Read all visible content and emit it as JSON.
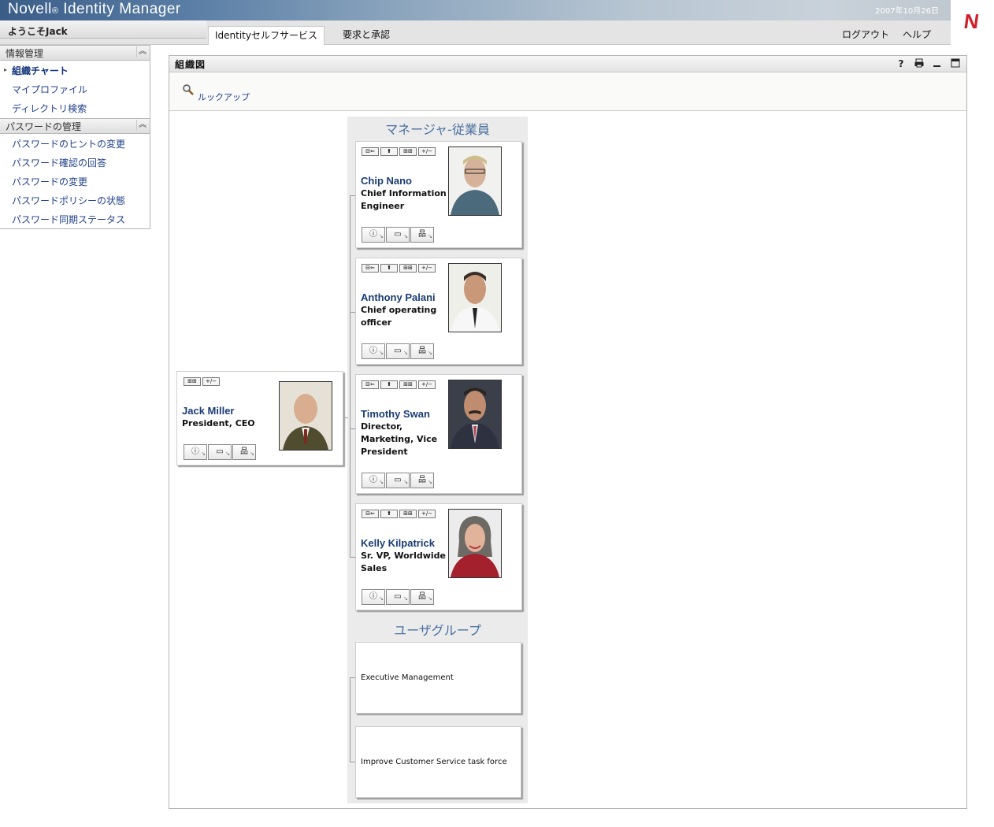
{
  "header": {
    "brand": "Novell",
    "brand_reg": "®",
    "product": "Identity Manager",
    "date": "2007年10月26日",
    "logo": "N",
    "welcome": "ようこそJack",
    "tabs": [
      "Identityセルフサービス",
      "要求と承認"
    ],
    "links": {
      "logout": "ログアウト",
      "help": "ヘルプ"
    }
  },
  "sidebar": {
    "sections": [
      {
        "title": "情報管理",
        "items": [
          "組織チャート",
          "マイプロファイル",
          "ディレクトリ検索"
        ],
        "selected": 0
      },
      {
        "title": "パスワードの管理",
        "items": [
          "パスワードのヒントの変更",
          "パスワード確認の回答",
          "パスワードの変更",
          "パスワードポリシーの状態",
          "パスワード同期ステータス"
        ]
      }
    ],
    "collapse_icon": "double-chevron-up-icon"
  },
  "portlet": {
    "title": "組織図",
    "controls": {
      "help": "?",
      "print": "print-icon",
      "minimize": "minimize-icon",
      "maximize": "maximize-icon"
    },
    "lookup_label": "ルックアップ"
  },
  "orgchart": {
    "root": {
      "name": "Jack Miller",
      "title_lines": [
        "President, CEO"
      ]
    },
    "reports_heading": "マネージャ-従業員",
    "reports": [
      {
        "name": "Chip Nano",
        "title_lines": [
          "Chief Information",
          "Engineer"
        ]
      },
      {
        "name": "Anthony Palani",
        "title_lines": [
          "Chief operating",
          "officer"
        ]
      },
      {
        "name": "Timothy Swan",
        "title_lines": [
          "Director,",
          "Marketing, Vice",
          "President"
        ]
      },
      {
        "name": "Kelly Kilpatrick",
        "title_lines": [
          "Sr. VP, Worldwide",
          "Sales"
        ]
      }
    ],
    "groups_heading": "ユーザグループ",
    "groups": [
      "Executive Management",
      "Improve Customer Service task force"
    ],
    "card_buttons": {
      "up_manager": "⊟⇐",
      "up": "⬆",
      "expand": "⊞⊞",
      "toggle": "+/−"
    },
    "action_buttons": {
      "info": "ⓘ",
      "email": "▭",
      "orgchart": "品"
    }
  }
}
